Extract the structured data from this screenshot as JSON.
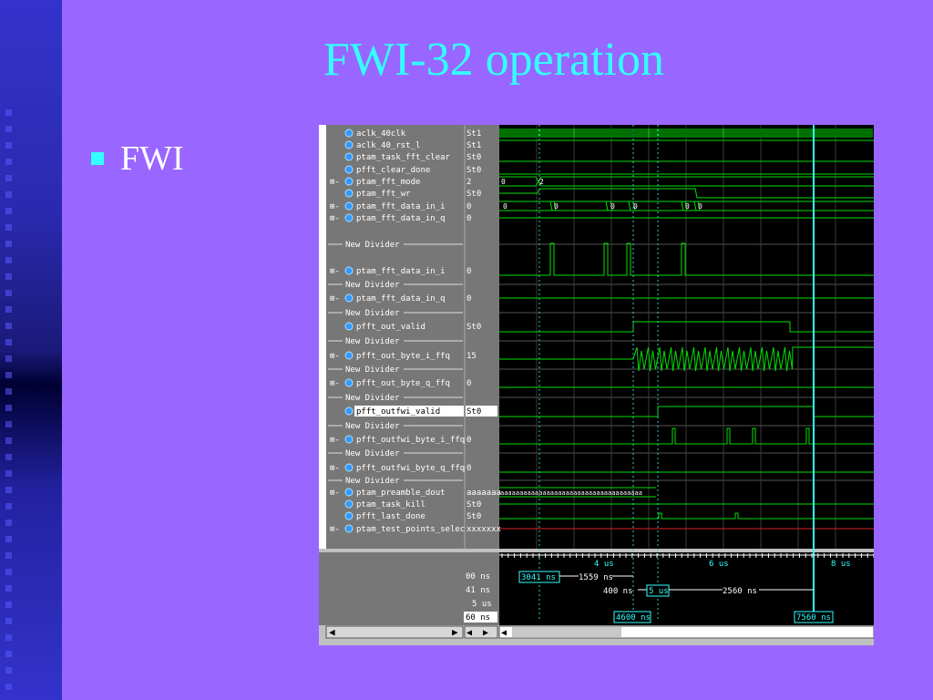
{
  "slide": {
    "title": "FWI-32 operation",
    "bullets": [
      "FWI"
    ],
    "accent_color": "#33ffff",
    "background_color": "#9966ff"
  },
  "waveform": {
    "signals": [
      {
        "name": "aclk_40clk",
        "value": "St1",
        "expand": false
      },
      {
        "name": "aclk_40_rst_l",
        "value": "St1",
        "expand": false
      },
      {
        "name": "ptam_task_fft_clear",
        "value": "St0",
        "expand": false
      },
      {
        "name": "pfft_clear_done",
        "value": "St0",
        "expand": false
      },
      {
        "name": "ptam_fft_mode",
        "value": "2",
        "expand": true
      },
      {
        "name": "ptam_fft_wr",
        "value": "St0",
        "expand": false
      },
      {
        "name": "ptam_fft_data_in_i",
        "value": "0",
        "expand": true
      },
      {
        "name": "ptam_fft_data_in_q",
        "value": "0",
        "expand": true
      },
      {
        "divider": "New Divider"
      },
      {
        "name": "ptam_fft_data_in_i",
        "value": "0",
        "expand": true
      },
      {
        "divider": "New Divider"
      },
      {
        "name": "ptam_fft_data_in_q",
        "value": "0",
        "expand": true
      },
      {
        "divider": "New Divider"
      },
      {
        "name": "pfft_out_valid",
        "value": "St0",
        "expand": false
      },
      {
        "divider": "New Divider"
      },
      {
        "name": "pfft_out_byte_i_ffq",
        "value": "15",
        "expand": true
      },
      {
        "divider": "New Divider"
      },
      {
        "name": "pfft_out_byte_q_ffq",
        "value": "0",
        "expand": true
      },
      {
        "divider": "New Divider"
      },
      {
        "name": "pfft_outfwi_valid",
        "value": "St0",
        "expand": false,
        "selected": true
      },
      {
        "divider": "New Divider"
      },
      {
        "name": "pfft_outfwi_byte_i_ffq",
        "value": "0",
        "expand": true
      },
      {
        "divider": "New Divider"
      },
      {
        "name": "pfft_outfwi_byte_q_ffq",
        "value": "0",
        "expand": true
      },
      {
        "divider": "New Divider"
      },
      {
        "name": "ptam_preamble_dout",
        "value": "aaaaaaa",
        "expand": true
      },
      {
        "name": "ptam_task_kill",
        "value": "St0",
        "expand": false
      },
      {
        "name": "pfft_last_done",
        "value": "St0",
        "expand": false
      },
      {
        "name": "ptam_test_points_selec",
        "value": "xxxxxxx",
        "expand": true
      }
    ],
    "bus_values": {
      "fft_mode_old": "0",
      "fft_mode_new": "2",
      "data_in_i": [
        "0",
        "0",
        "0",
        "0",
        "0",
        "0",
        "0",
        "0"
      ],
      "preamble": "aaaaaaaaaaaaaaaaaaaaaaaaaaaaaaaaaaaaa"
    },
    "timeline": {
      "ticks": [
        "4 us",
        "6 us",
        "8 us"
      ],
      "left_labels": [
        "00 ns",
        "41 ns",
        "5 us",
        "60 ns"
      ],
      "cursor_1": "3041 ns",
      "delta_1": "1559 ns",
      "delta_2": "400 ns",
      "cursor_2": "5 us",
      "delta_3": "2560 ns",
      "cursor_3": "4600 ns",
      "cursor_4": "7560 ns"
    },
    "colors": {
      "wave": "#00e000",
      "cursor": "#33ffff",
      "dotted_cursor": "#33cccc",
      "bad": "#dd2222"
    }
  }
}
